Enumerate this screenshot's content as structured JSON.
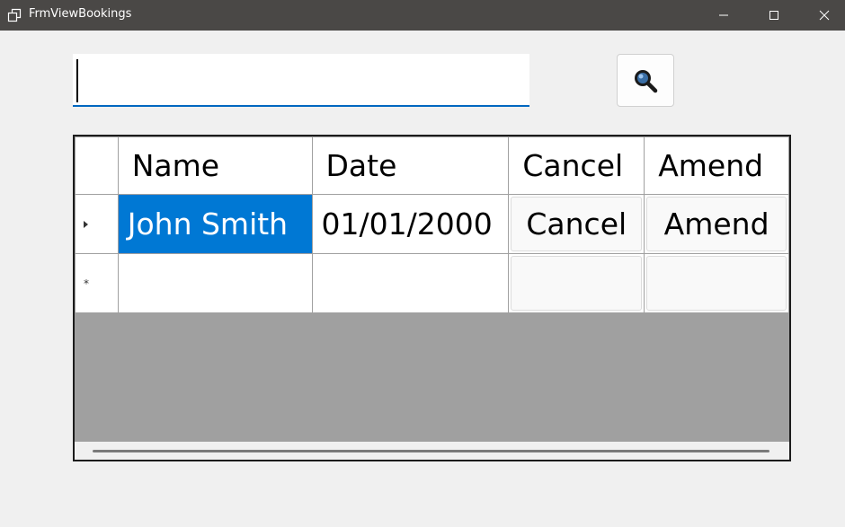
{
  "window": {
    "title": "FrmViewBookings",
    "icons": {
      "app": "restore-windows-icon",
      "minimize": "minimize-icon",
      "maximize": "maximize-icon",
      "close": "close-icon"
    }
  },
  "search": {
    "value": "",
    "button_icon": "search-magnifier-icon"
  },
  "grid": {
    "columns": [
      "Name",
      "Date",
      "Cancel",
      "Amend"
    ],
    "rows": [
      {
        "name": "John Smith",
        "date": "01/01/2000",
        "cancel": "Cancel",
        "amend": "Amend",
        "selected_cell": "name"
      }
    ],
    "new_row": {
      "cancel": "",
      "amend": ""
    }
  },
  "colors": {
    "titlebar": "#4a4846",
    "selection": "#0078d4",
    "grid_background": "#a0a0a0",
    "input_underline": "#0067c0"
  }
}
